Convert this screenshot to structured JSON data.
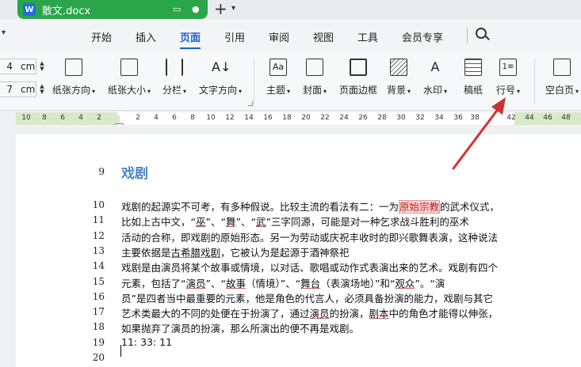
{
  "titlebar": {
    "doc_name": "散文.docx",
    "logo_letter": "W",
    "new_tab": "+"
  },
  "menu": {
    "items": [
      "开始",
      "插入",
      "页面",
      "引用",
      "审阅",
      "视图",
      "工具",
      "会员专享"
    ],
    "active_index": 2
  },
  "ribbon": {
    "margins": [
      {
        "value": "4",
        "unit": "cm"
      },
      {
        "value": "7",
        "unit": "cm"
      }
    ],
    "buttons": [
      {
        "label": "纸张方向",
        "dropdown": true
      },
      {
        "label": "纸张大小",
        "dropdown": true
      },
      {
        "label": "分栏",
        "dropdown": true
      },
      {
        "label": "文字方向",
        "dropdown": true
      },
      {
        "label": "主题",
        "dropdown": true
      },
      {
        "label": "封面",
        "dropdown": true
      },
      {
        "label": "页面边框",
        "dropdown": false
      },
      {
        "label": "背景",
        "dropdown": true
      },
      {
        "label": "水印",
        "dropdown": true
      },
      {
        "label": "稿纸",
        "dropdown": false
      },
      {
        "label": "行号",
        "dropdown": true
      },
      {
        "label": "空白页",
        "dropdown": true
      }
    ]
  },
  "ruler": {
    "numbers": [
      "10",
      "8",
      "6",
      "4",
      "2",
      "2",
      "4",
      "6",
      "8",
      "10",
      "12",
      "14",
      "16",
      "18",
      "20",
      "22",
      "24",
      "26",
      "28",
      "30",
      "32",
      "34",
      "36",
      "38",
      "42",
      "44",
      "46",
      "48"
    ]
  },
  "document": {
    "heading_line": "9",
    "heading": "戏剧",
    "lines": [
      {
        "num": "10",
        "segments": [
          {
            "t": "戏剧的起源实不可考，有多种假说。比较主流的看法有二：一为"
          },
          {
            "t": "原始宗教",
            "style": "box"
          },
          {
            "t": "的武术仪式，"
          }
        ]
      },
      {
        "num": "11",
        "segments": [
          {
            "t": "比如上古中文，“"
          },
          {
            "t": "巫",
            "style": "u"
          },
          {
            "t": "”、“"
          },
          {
            "t": "舞",
            "style": "u"
          },
          {
            "t": "”、“"
          },
          {
            "t": "武",
            "style": "u"
          },
          {
            "t": "”三字同源，可能是对一种乞求战斗胜利的巫术"
          }
        ]
      },
      {
        "num": "12",
        "segments": [
          {
            "t": "活动的合称，即戏剧的原始形态。另一为劳动或庆祝丰收时的即兴歌舞表演，这种说法"
          }
        ]
      },
      {
        "num": "13",
        "segments": [
          {
            "t": "主要依据是"
          },
          {
            "t": "古希腊戏剧",
            "style": "u"
          },
          {
            "t": "，它被认为是起源于酒神祭祀"
          }
        ]
      },
      {
        "num": "14",
        "segments": [
          {
            "t": "戏剧是由演员将某个故事或情境，以对话、歌唱或动作式表演出来的艺术。戏剧有四个"
          }
        ]
      },
      {
        "num": "15",
        "segments": [
          {
            "t": "元素，包括了“"
          },
          {
            "t": "演员",
            "style": "u"
          },
          {
            "t": "”、“"
          },
          {
            "t": "故事",
            "style": "u"
          },
          {
            "t": "（情境）”、“"
          },
          {
            "t": "舞台",
            "style": "u"
          },
          {
            "t": "（表演场地）”和“"
          },
          {
            "t": "观众",
            "style": "u"
          },
          {
            "t": "”。“演"
          }
        ]
      },
      {
        "num": "16",
        "segments": [
          {
            "t": "员”是四者当中最重要的元素，他是角色的代言人，必须具备扮演的能力，戏剧与其它"
          }
        ]
      },
      {
        "num": "17",
        "segments": [
          {
            "t": "艺术类最大的不同的处便在于扮演了，通过"
          },
          {
            "t": "演员",
            "style": "u"
          },
          {
            "t": "的扮演，"
          },
          {
            "t": "剧本",
            "style": "u"
          },
          {
            "t": "中的角色才能得以伸张，"
          }
        ]
      },
      {
        "num": "18",
        "segments": [
          {
            "t": "如果抛弃了演员的扮演，那么所演出的便不再是戏剧。"
          }
        ]
      },
      {
        "num": "19",
        "segments": [
          {
            "t": "11: 33: 11"
          }
        ]
      },
      {
        "num": "20",
        "segments": []
      }
    ]
  },
  "colors": {
    "tab_green": "#2ba54a",
    "accent_blue": "#1a5fcf",
    "heading_blue": "#4a86c8",
    "arrow_red": "#d32f2f",
    "ruler_green": "#d7e9c8"
  }
}
